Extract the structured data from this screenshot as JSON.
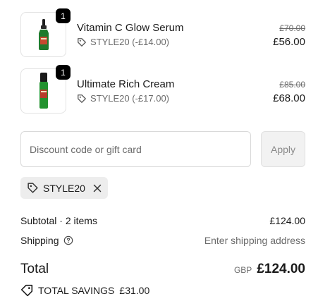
{
  "line_items": [
    {
      "quantity": "1",
      "name": "Vitamin C Glow Serum",
      "discount": "STYLE20 (-£14.00)",
      "original_price": "£70.00",
      "price": "£56.00"
    },
    {
      "quantity": "1",
      "name": "Ultimate Rich Cream",
      "discount": "STYLE20 (-£17.00)",
      "original_price": "£85.00",
      "price": "£68.00"
    }
  ],
  "discount": {
    "placeholder": "Discount code or gift card",
    "apply_label": "Apply",
    "applied_code": "STYLE20"
  },
  "summary": {
    "subtotal_label": "Subtotal · 2 items",
    "subtotal_value": "£124.00",
    "shipping_label": "Shipping",
    "shipping_value": "Enter shipping address",
    "total_label": "Total",
    "currency": "GBP",
    "total_value": "£124.00",
    "savings_label": "TOTAL SAVINGS",
    "savings_value": "£31.00"
  },
  "icons": {
    "tag": "tag-icon",
    "close": "close-icon",
    "help": "help-circle-icon",
    "savings_tag": "savings-tag-icon"
  },
  "colors": {
    "badge": "#000000",
    "muted_text": "#6b6b6b",
    "chip_background": "#ededed",
    "apply_disabled": "#f2f2f2"
  }
}
